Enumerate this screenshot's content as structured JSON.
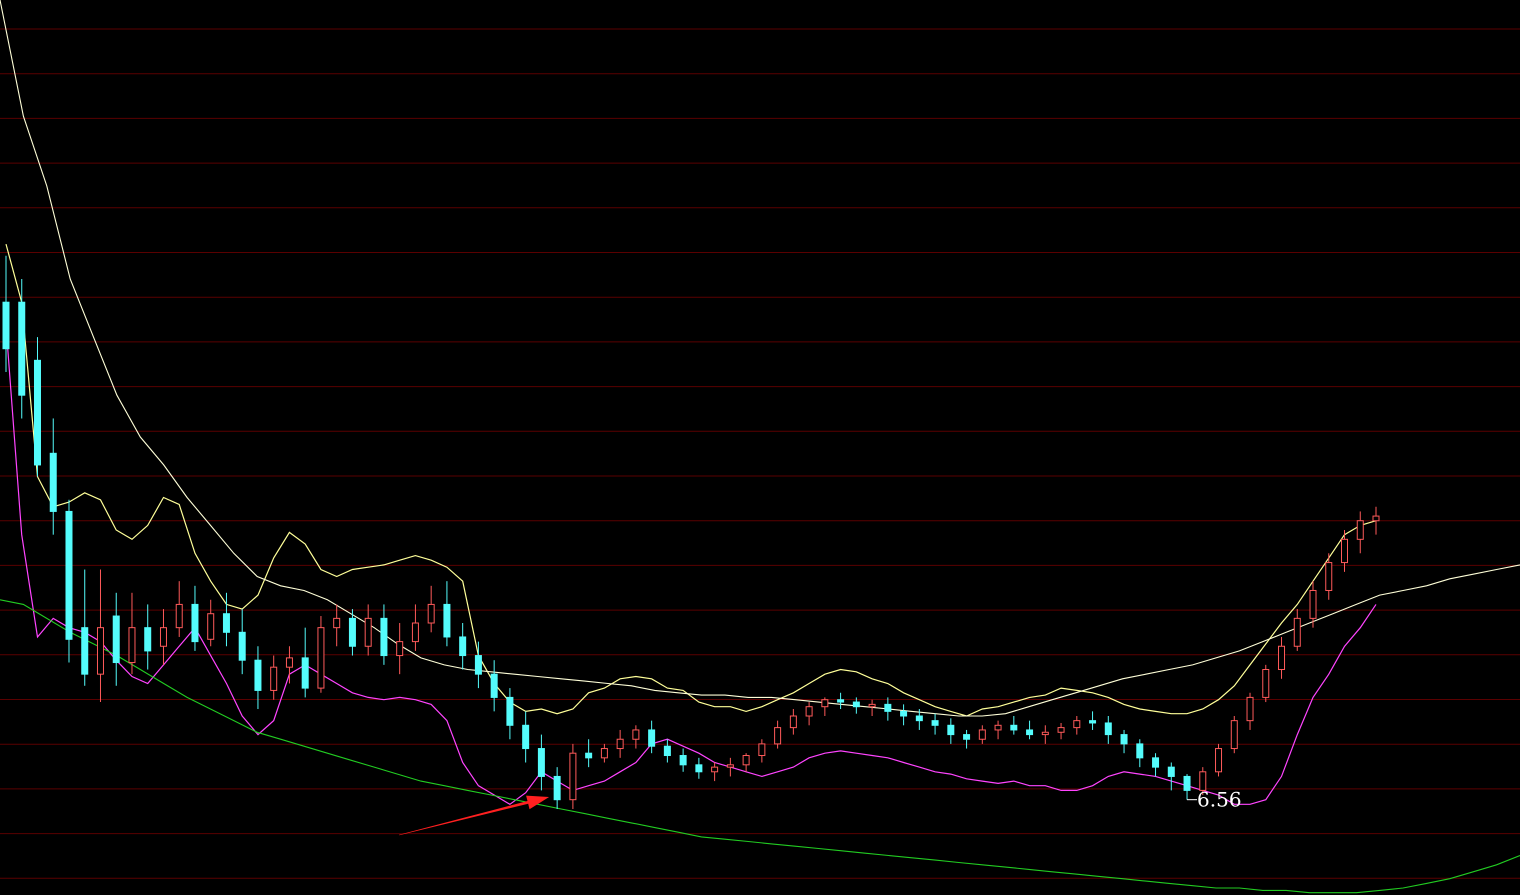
{
  "chart_data": {
    "type": "candlestick",
    "colors": {
      "background": "#000000",
      "grid": "#5a0000",
      "up_candle": "#ff5a5a",
      "down_candle": "#54fcfc",
      "band_upper": "#ffff99",
      "band_lower": "#ff44ff",
      "ma_long": "#ffffd8",
      "ma_very_long": "#22cc22",
      "annotation_arrow": "#ff2020"
    },
    "grid": true,
    "candles": [
      [
        8.7,
        8.9,
        8.5,
        8.4
      ],
      [
        8.7,
        8.8,
        8.3,
        8.2
      ],
      [
        8.45,
        8.55,
        8.0,
        7.95
      ],
      [
        8.05,
        8.2,
        7.8,
        7.7
      ],
      [
        7.8,
        7.85,
        7.25,
        7.15
      ],
      [
        7.3,
        7.55,
        7.1,
        7.05
      ],
      [
        7.1,
        7.55,
        7.3,
        6.98
      ],
      [
        7.35,
        7.45,
        7.15,
        7.05
      ],
      [
        7.15,
        7.45,
        7.3,
        7.1
      ],
      [
        7.3,
        7.4,
        7.2,
        7.12
      ],
      [
        7.22,
        7.38,
        7.3,
        7.14
      ],
      [
        7.3,
        7.5,
        7.4,
        7.26
      ],
      [
        7.4,
        7.48,
        7.24,
        7.2
      ],
      [
        7.25,
        7.42,
        7.36,
        7.22
      ],
      [
        7.36,
        7.45,
        7.28,
        7.22
      ],
      [
        7.28,
        7.38,
        7.16,
        7.1
      ],
      [
        7.16,
        7.22,
        7.03,
        6.95
      ],
      [
        7.03,
        7.18,
        7.13,
        6.99
      ],
      [
        7.13,
        7.22,
        7.17,
        7.06
      ],
      [
        7.17,
        7.3,
        7.04,
        7.0
      ],
      [
        7.04,
        7.35,
        7.3,
        7.02
      ],
      [
        7.3,
        7.4,
        7.34,
        7.22
      ],
      [
        7.34,
        7.38,
        7.22,
        7.18
      ],
      [
        7.22,
        7.4,
        7.34,
        7.18
      ],
      [
        7.34,
        7.4,
        7.18,
        7.14
      ],
      [
        7.18,
        7.32,
        7.24,
        7.1
      ],
      [
        7.24,
        7.4,
        7.32,
        7.2
      ],
      [
        7.32,
        7.48,
        7.4,
        7.28
      ],
      [
        7.4,
        7.5,
        7.26,
        7.22
      ],
      [
        7.26,
        7.32,
        7.18,
        7.12
      ],
      [
        7.18,
        7.24,
        7.1,
        7.04
      ],
      [
        7.1,
        7.16,
        7.0,
        6.94
      ],
      [
        7.0,
        7.04,
        6.88,
        6.82
      ],
      [
        6.88,
        6.94,
        6.78,
        6.72
      ],
      [
        6.78,
        6.84,
        6.66,
        6.6
      ],
      [
        6.66,
        6.7,
        6.56,
        6.52
      ],
      [
        6.56,
        6.8,
        6.76,
        6.52
      ],
      [
        6.76,
        6.82,
        6.74,
        6.7
      ],
      [
        6.74,
        6.8,
        6.78,
        6.72
      ],
      [
        6.78,
        6.86,
        6.82,
        6.74
      ],
      [
        6.82,
        6.88,
        6.86,
        6.78
      ],
      [
        6.86,
        6.9,
        6.79,
        6.76
      ],
      [
        6.79,
        6.82,
        6.75,
        6.72
      ],
      [
        6.75,
        6.78,
        6.71,
        6.68
      ],
      [
        6.71,
        6.74,
        6.68,
        6.65
      ],
      [
        6.68,
        6.72,
        6.7,
        6.64
      ],
      [
        6.7,
        6.74,
        6.71,
        6.66
      ],
      [
        6.71,
        6.76,
        6.75,
        6.68
      ],
      [
        6.75,
        6.82,
        6.8,
        6.72
      ],
      [
        6.8,
        6.9,
        6.87,
        6.78
      ],
      [
        6.87,
        6.95,
        6.92,
        6.84
      ],
      [
        6.92,
        6.98,
        6.96,
        6.88
      ],
      [
        6.96,
        7.0,
        6.99,
        6.92
      ],
      [
        6.99,
        7.02,
        6.98,
        6.95
      ],
      [
        6.98,
        7.0,
        6.96,
        6.93
      ],
      [
        6.96,
        6.99,
        6.97,
        6.92
      ],
      [
        6.97,
        7.0,
        6.94,
        6.9
      ],
      [
        6.94,
        6.97,
        6.92,
        6.88
      ],
      [
        6.92,
        6.95,
        6.9,
        6.86
      ],
      [
        6.9,
        6.93,
        6.88,
        6.84
      ],
      [
        6.88,
        6.91,
        6.84,
        6.8
      ],
      [
        6.84,
        6.86,
        6.82,
        6.78
      ],
      [
        6.82,
        6.88,
        6.86,
        6.8
      ],
      [
        6.86,
        6.9,
        6.88,
        6.82
      ],
      [
        6.88,
        6.92,
        6.86,
        6.84
      ],
      [
        6.86,
        6.9,
        6.84,
        6.82
      ],
      [
        6.84,
        6.88,
        6.85,
        6.8
      ],
      [
        6.85,
        6.89,
        6.87,
        6.82
      ],
      [
        6.87,
        6.92,
        6.9,
        6.84
      ],
      [
        6.9,
        6.94,
        6.89,
        6.86
      ],
      [
        6.89,
        6.92,
        6.84,
        6.8
      ],
      [
        6.84,
        6.86,
        6.8,
        6.76
      ],
      [
        6.8,
        6.82,
        6.74,
        6.7
      ],
      [
        6.74,
        6.76,
        6.7,
        6.66
      ],
      [
        6.7,
        6.72,
        6.66,
        6.6
      ],
      [
        6.66,
        6.67,
        6.6,
        6.56
      ],
      [
        6.6,
        6.7,
        6.68,
        6.58
      ],
      [
        6.68,
        6.8,
        6.78,
        6.66
      ],
      [
        6.78,
        6.92,
        6.9,
        6.76
      ],
      [
        6.9,
        7.02,
        7.0,
        6.86
      ],
      [
        7.0,
        7.14,
        7.12,
        6.98
      ],
      [
        7.12,
        7.26,
        7.22,
        7.08
      ],
      [
        7.22,
        7.38,
        7.34,
        7.2
      ],
      [
        7.34,
        7.5,
        7.46,
        7.3
      ],
      [
        7.46,
        7.62,
        7.58,
        7.42
      ],
      [
        7.58,
        7.72,
        7.68,
        7.54
      ],
      [
        7.68,
        7.8,
        7.76,
        7.62
      ],
      [
        7.76,
        7.82,
        7.78,
        7.7
      ]
    ],
    "band_upper": [
      8.95,
      8.7,
      7.95,
      7.82,
      7.84,
      7.88,
      7.85,
      7.72,
      7.68,
      7.74,
      7.86,
      7.83,
      7.62,
      7.5,
      7.4,
      7.38,
      7.44,
      7.6,
      7.71,
      7.66,
      7.55,
      7.52,
      7.55,
      7.56,
      7.57,
      7.59,
      7.61,
      7.59,
      7.56,
      7.5,
      7.18,
      7.06,
      6.98,
      6.94,
      6.95,
      6.93,
      6.95,
      7.02,
      7.04,
      7.08,
      7.09,
      7.08,
      7.04,
      7.03,
      6.98,
      6.96,
      6.96,
      6.94,
      6.96,
      6.99,
      7.02,
      7.06,
      7.1,
      7.12,
      7.11,
      7.08,
      7.06,
      7.02,
      6.99,
      6.96,
      6.94,
      6.92,
      6.95,
      6.96,
      6.98,
      7.0,
      7.01,
      7.04,
      7.03,
      7.02,
      7.0,
      6.97,
      6.95,
      6.94,
      6.93,
      6.93,
      6.95,
      6.99,
      7.05,
      7.14,
      7.23,
      7.32,
      7.4,
      7.5,
      7.6,
      7.7,
      7.74,
      7.76
    ],
    "band_lower": [
      8.6,
      7.7,
      7.26,
      7.34,
      7.3,
      7.28,
      7.24,
      7.16,
      7.09,
      7.06,
      7.14,
      7.22,
      7.3,
      7.18,
      7.06,
      6.92,
      6.84,
      6.9,
      7.1,
      7.14,
      7.1,
      7.06,
      7.02,
      7.0,
      6.99,
      7.0,
      6.99,
      6.97,
      6.9,
      6.72,
      6.62,
      6.58,
      6.54,
      6.59,
      6.68,
      6.64,
      6.6,
      6.62,
      6.64,
      6.68,
      6.72,
      6.8,
      6.82,
      6.79,
      6.76,
      6.72,
      6.7,
      6.68,
      6.66,
      6.68,
      6.7,
      6.74,
      6.76,
      6.77,
      6.76,
      6.75,
      6.74,
      6.72,
      6.7,
      6.68,
      6.67,
      6.65,
      6.64,
      6.63,
      6.64,
      6.62,
      6.62,
      6.6,
      6.6,
      6.62,
      6.66,
      6.68,
      6.67,
      6.66,
      6.64,
      6.62,
      6.6,
      6.58,
      6.54,
      6.54,
      6.56,
      6.66,
      6.84,
      7.0,
      7.1,
      7.22,
      7.3,
      7.4
    ],
    "ma_long": [
      10.0,
      9.5,
      9.2,
      8.8,
      8.55,
      8.3,
      8.12,
      8.0,
      7.86,
      7.74,
      7.62,
      7.52,
      7.48,
      7.46,
      7.42,
      7.36,
      7.3,
      7.23,
      7.17,
      7.14,
      7.12,
      7.11,
      7.1,
      7.09,
      7.08,
      7.07,
      7.06,
      7.05,
      7.03,
      7.02,
      7.01,
      7.01,
      7.0,
      7.0,
      6.99,
      6.98,
      6.97,
      6.96,
      6.95,
      6.94,
      6.93,
      6.92,
      6.92,
      6.93,
      6.96,
      6.99,
      7.02,
      7.05,
      7.08,
      7.1,
      7.12,
      7.14,
      7.17,
      7.2,
      7.24,
      7.28,
      7.32,
      7.36,
      7.4,
      7.44,
      7.46,
      7.48,
      7.51,
      7.53,
      7.55,
      7.57
    ],
    "ma_very_long": [
      7.42,
      7.4,
      7.34,
      7.28,
      7.23,
      7.18,
      7.12,
      7.06,
      7.0,
      6.95,
      6.9,
      6.85,
      6.82,
      6.79,
      6.76,
      6.73,
      6.7,
      6.67,
      6.64,
      6.62,
      6.6,
      6.58,
      6.56,
      6.54,
      6.52,
      6.5,
      6.48,
      6.46,
      6.44,
      6.42,
      6.4,
      6.39,
      6.38,
      6.37,
      6.36,
      6.35,
      6.34,
      6.33,
      6.32,
      6.31,
      6.3,
      6.29,
      6.28,
      6.27,
      6.26,
      6.25,
      6.24,
      6.23,
      6.22,
      6.21,
      6.2,
      6.19,
      6.18,
      6.18,
      6.17,
      6.17,
      6.16,
      6.16,
      6.16,
      6.17,
      6.18,
      6.2,
      6.22,
      6.25,
      6.28,
      6.32
    ],
    "low_marker": {
      "label": "6.56",
      "index": 75,
      "value": 6.56
    },
    "annotation_arrow": {
      "points_at_index": 35,
      "direction": "up-right"
    }
  }
}
